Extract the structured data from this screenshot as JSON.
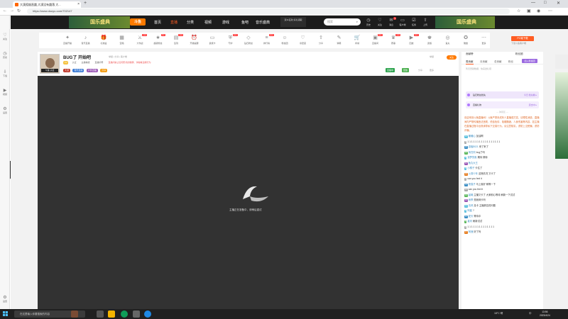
{
  "browser": {
    "tab_title": "大漠孤烟直圆,大漠没有圆落 大...",
    "url": "https://www.douyu.com/702147",
    "new_tab": "+",
    "window_controls": [
      "—",
      "□",
      "✕"
    ]
  },
  "left_sidebar": {
    "items": [
      {
        "icon": "heart-icon",
        "label": "关注"
      },
      {
        "icon": "clock-icon",
        "label": "历史"
      },
      {
        "icon": "download-icon",
        "label": "下载"
      },
      {
        "icon": "video-icon",
        "label": "视频"
      },
      {
        "icon": "gear-icon",
        "label": "设置"
      }
    ],
    "bottom_label": "设置"
  },
  "topnav": {
    "banner_text": "国乐盛典",
    "logo": "斗鱼",
    "links": [
      {
        "label": "首页",
        "active": false
      },
      {
        "label": "直播",
        "active": true
      },
      {
        "label": "分类",
        "active": false
      },
      {
        "label": "视频",
        "active": false
      },
      {
        "label": "游戏",
        "active": false
      },
      {
        "label": "鱼吧",
        "active": false
      },
      {
        "label": "音乐盛典",
        "active": false
      }
    ],
    "hot_box": "双11狂欢 好礼领取",
    "search_placeholder": "搜索",
    "icons": [
      {
        "name": "history-icon",
        "label": "历史"
      },
      {
        "name": "follow-icon",
        "label": "关注"
      },
      {
        "name": "message-icon",
        "label": "消息",
        "badge": "3"
      },
      {
        "name": "client-icon",
        "label": "客户端"
      },
      {
        "name": "task-icon",
        "label": "任务"
      },
      {
        "name": "upload-icon",
        "label": "上传"
      }
    ],
    "right_banner": "国乐盛典"
  },
  "category_row": {
    "level_number": "12",
    "level_label": "等级特权",
    "items": [
      {
        "icon": "game-icon",
        "label": "直播开播",
        "badge": ""
      },
      {
        "icon": "music-icon",
        "label": "音乐直播",
        "badge": ""
      },
      {
        "icon": "gift-icon",
        "label": "礼物盒",
        "badge": ""
      },
      {
        "icon": "box-icon",
        "label": "宝箱",
        "badge": ""
      },
      {
        "icon": "gun-icon",
        "label": "大作战",
        "badge": "new"
      },
      {
        "icon": "star-icon",
        "label": "超级粉丝",
        "badge": "hot"
      },
      {
        "icon": "calendar-icon",
        "label": "签到",
        "badge": "new"
      },
      {
        "icon": "alarm-icon",
        "label": "开播提醒",
        "badge": ""
      },
      {
        "icon": "card-icon",
        "label": "贵族卡",
        "badge": ""
      },
      {
        "icon": "shield-icon",
        "label": "守护",
        "badge": "new"
      },
      {
        "icon": "diamond-icon",
        "label": "钻石粉丝",
        "badge": ""
      },
      {
        "icon": "rank-icon",
        "label": "排行榜",
        "badge": "new"
      },
      {
        "icon": "people-icon",
        "label": "粉丝团",
        "badge": ""
      },
      {
        "icon": "heart-icon",
        "label": "亲密度",
        "badge": ""
      },
      {
        "icon": "share-icon",
        "label": "分享",
        "badge": ""
      },
      {
        "icon": "edit-icon",
        "label": "弹幕",
        "badge": ""
      },
      {
        "icon": "cart-icon",
        "label": "商城",
        "badge": ""
      },
      {
        "icon": "tv-icon",
        "label": "直播间",
        "badge": "new"
      },
      {
        "icon": "trophy-icon",
        "label": "赛事",
        "badge": "new"
      },
      {
        "icon": "play-icon",
        "label": "回放",
        "badge": "new"
      },
      {
        "icon": "crown-icon",
        "label": "贵族",
        "badge": ""
      },
      {
        "icon": "coin-icon",
        "label": "鱼丸",
        "badge": ""
      },
      {
        "icon": "medal-icon",
        "label": "徽章",
        "badge": ""
      },
      {
        "icon": "more-icon",
        "label": "更多",
        "badge": ""
      }
    ],
    "pc_button": "PC端下载",
    "pc_sub": "下载斗鱼客户端"
  },
  "streamer": {
    "avatar_caption": "斗鱼 认证",
    "title": "BUG了 开始吧",
    "meta": "举报 | 分享 | 客户端",
    "row2_tag": "LV",
    "row2_items": [
      "认证",
      "主播等级",
      "直播间号"
    ],
    "warning": "直播间禁止任何形式的赌博、诈骗等违规行为",
    "row3_chips": [
      {
        "label": "大漠",
        "color": "#c0392b"
      },
      {
        "label": "音乐直播",
        "color": "#3a7bd5"
      },
      {
        "label": "户外直播",
        "color": "#9b59b6"
      },
      {
        "label": "分享",
        "color": "#f39c12"
      }
    ],
    "follow": "关注",
    "report": "举报",
    "hot_label": "热度值",
    "viewers_label": "观看",
    "live_chip": "直播中",
    "replay_chip": "回放",
    "share_link": "分享",
    "more_link": "更多"
  },
  "video": {
    "loading_text": "主播正在准备中，请稍后重试"
  },
  "right_panel": {
    "contrib_title": "贡献榜",
    "fans_title": "粉丝团",
    "tabs": [
      {
        "label": "周贡献",
        "active": true
      },
      {
        "label": "月贡献",
        "active": false
      },
      {
        "label": "总贡献",
        "active": false
      },
      {
        "label": "粉丝",
        "active": false
      }
    ],
    "join_button": "加入粉丝团",
    "sub_text": "暂无贡献数据，快来送礼吧",
    "bars": [
      {
        "label": "钻石粉丝抢先",
        "extra": "今日 抢先看 ▸",
        "bg": "#efe6fb"
      },
      {
        "label": "直播礼物",
        "extra": "连击中 ▸",
        "bg": "#f4edfd"
      }
    ],
    "divider_text": "— 弹幕区 —",
    "system_msg": "欢迎来到斗鱼直播间！斗鱼严禁未成年人直播或打赏，请理性消费。直播间内严禁传播违法违规、低俗色情、吸烟酗酒、人身伤害等内容，如主播在直播过程中出现诱导私下交易行为，请注意核实，谨防上当受骗，谨防诈骗。",
    "messages": [
      {
        "lv": "12",
        "name": "暖暖心",
        "text": "加油啊",
        "color": "#5bc0de"
      },
      {
        "lv": "8",
        "name": "",
        "text": "1 1 1 1 1 1 1 1 1 1 1 1 1 1 1 1 1",
        "color": "#aaa"
      },
      {
        "lv": "20",
        "name": "游客8021",
        "text": "来了来了",
        "color": "#3b8ec4"
      },
      {
        "lv": "15",
        "name": "风在吹",
        "text": "bug了吗",
        "color": "#5cb85c"
      },
      {
        "lv": "9",
        "name": "追梦的鱼",
        "text": "期待 期待",
        "color": "#5bc0de"
      },
      {
        "lv": "11",
        "name": "鱼丸大王",
        "text": "",
        "color": "#9b59b6"
      },
      {
        "lv": "6",
        "name": "小橘子",
        "text": "卡住了",
        "color": "#5bc0de"
      },
      {
        "lv": "18",
        "name": "火箭少年",
        "text": "这啥情况 又卡了",
        "color": "#e67e22"
      },
      {
        "lv": "7",
        "name": "",
        "text": "can you feel it",
        "color": "#aaa"
      },
      {
        "lv": "13",
        "name": "夜猫子",
        "text": "马上就好 稍等一下",
        "color": "#3b8ec4"
      },
      {
        "lv": "10",
        "name": "",
        "text": "can you feel it",
        "color": "#aaa"
      },
      {
        "lv": "16",
        "name": "晨曦",
        "text": "主播又卡了 大家耐心等待 刷新一下试试",
        "color": "#5cb85c"
      },
      {
        "lv": "19",
        "name": "雨季",
        "text": "是我网卡吗",
        "color": "#9b59b6"
      },
      {
        "lv": "14",
        "name": "清风",
        "text": "没卡 主播那边的问题",
        "color": "#5bc0de"
      },
      {
        "lv": "8",
        "name": "阿星",
        "text": "?",
        "color": "#5bc0de"
      },
      {
        "lv": "12",
        "name": "夏天",
        "text": "等待中",
        "color": "#3b8ec4"
      },
      {
        "lv": "5",
        "name": "星河",
        "text": "刷新试试",
        "color": "#5cb85c"
      },
      {
        "lv": "9",
        "name": "",
        "text": "1 1 1 1 1 1 1 1 1 1 1 1 1 1",
        "color": "#aaa"
      },
      {
        "lv": "17",
        "name": "阿狸",
        "text": "好了吗",
        "color": "#e67e22"
      }
    ]
  },
  "taskbar": {
    "search_placeholder": "在这里输入你要搜索的内容",
    "temperature": "18°C 晴",
    "lang": "中",
    "time": "13:56",
    "date": "2023/4/24"
  }
}
